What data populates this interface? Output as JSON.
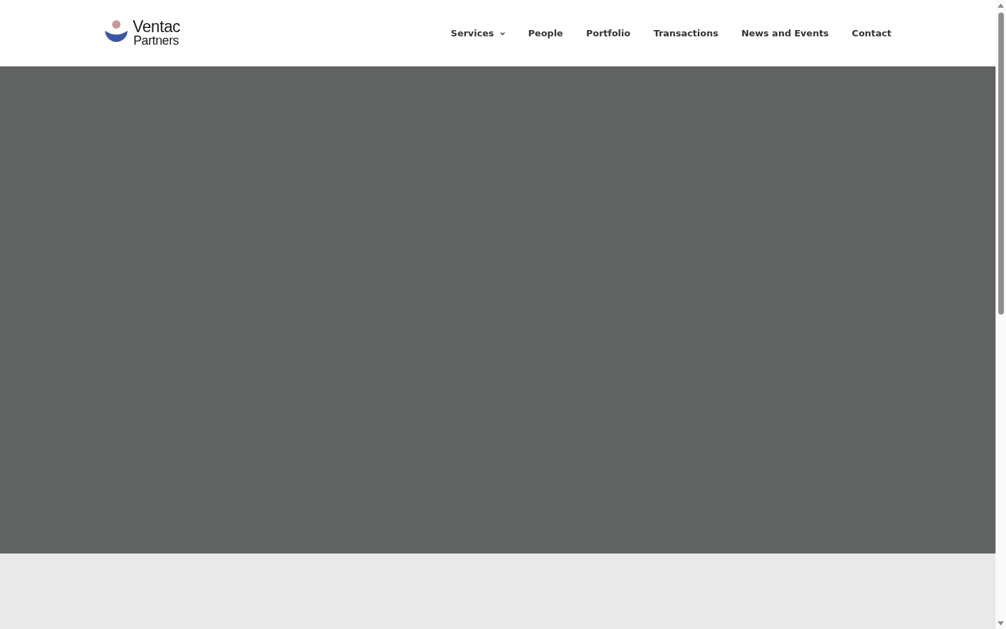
{
  "header": {
    "logo": {
      "lines": [
        "Ventac",
        "Partners"
      ]
    },
    "nav": [
      {
        "label": "Services",
        "kind": "dropdown"
      },
      {
        "label": "People",
        "kind": "link"
      },
      {
        "label": "Portfolio",
        "kind": "link"
      },
      {
        "label": "Transactions",
        "kind": "link"
      },
      {
        "label": "News and Events",
        "kind": "link"
      },
      {
        "label": "Contact",
        "kind": "link"
      }
    ]
  }
}
